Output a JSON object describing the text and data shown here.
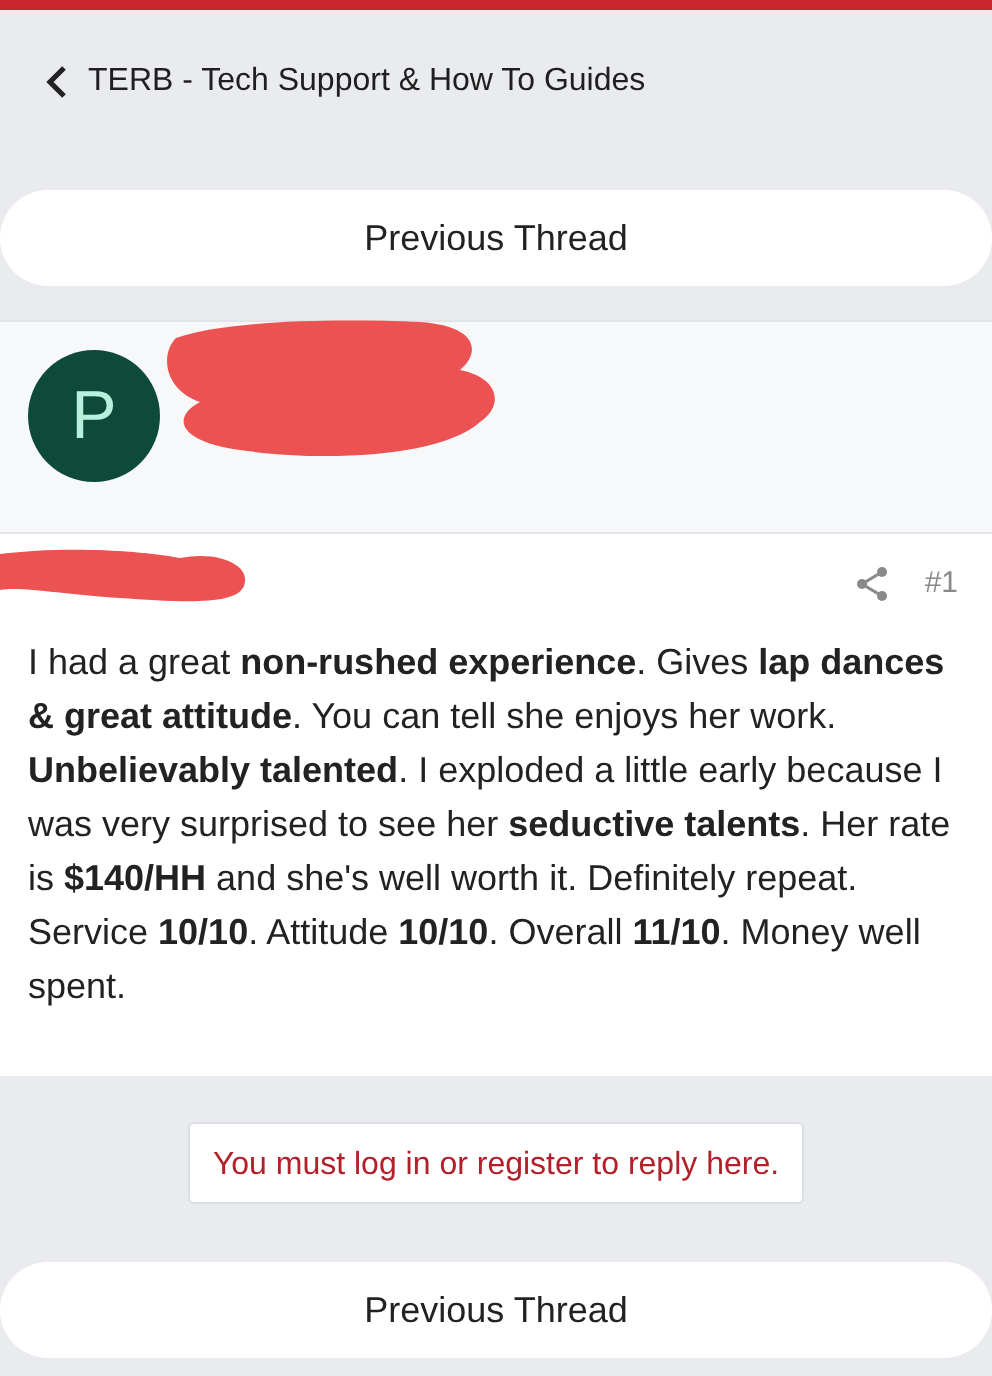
{
  "breadcrumb": {
    "label": "TERB - Tech Support & How To Guides"
  },
  "previous_thread_top": {
    "label": "Previous Thread"
  },
  "author": {
    "avatar_letter": "P"
  },
  "post": {
    "number": "#1",
    "body": "I had a great **non-rushed experience**. Gives **lap dances & great attitude**. You can tell she enjoys her work. **Unbelievably talented**. I exploded a little early because I was very surprised to see her **seductive talents**. Her rate is **$140/HH** and she's well worth it. Definitely repeat. Service **10/10**. Attitude **10/10**. Overall **11/10**. Money well spent."
  },
  "reply_notice": {
    "label": "You must log in or register to reply here."
  },
  "previous_thread_bottom": {
    "label": "Previous Thread"
  }
}
